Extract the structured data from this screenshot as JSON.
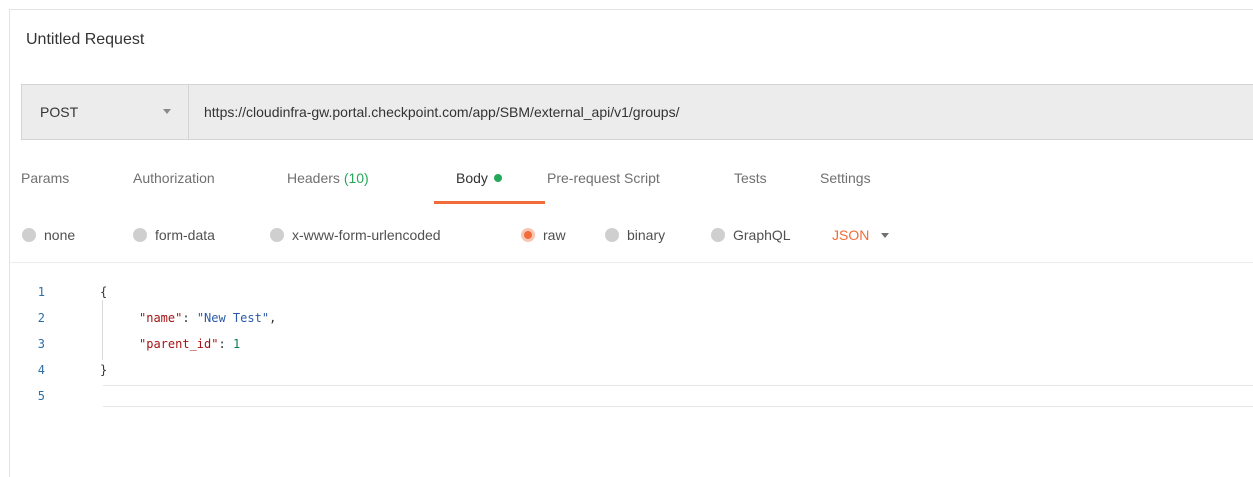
{
  "request": {
    "title": "Untitled Request",
    "method": "POST",
    "url": "https://cloudinfra-gw.portal.checkpoint.com/app/SBM/external_api/v1/groups/"
  },
  "tabs": {
    "params": "Params",
    "authorization": "Authorization",
    "headers": "Headers",
    "headers_count": "(10)",
    "body": "Body",
    "prerequest": "Pre-request Script",
    "tests": "Tests",
    "settings": "Settings"
  },
  "body_modes": {
    "none": "none",
    "form_data": "form-data",
    "urlencoded": "x-www-form-urlencoded",
    "raw": "raw",
    "binary": "binary",
    "graphql": "GraphQL",
    "format": "JSON",
    "selected": "raw"
  },
  "editor": {
    "line_numbers": [
      "1",
      "2",
      "3",
      "4",
      "5"
    ],
    "open_brace": "{",
    "close_brace": "}",
    "key1": "\"name\"",
    "val1": "\"New Test\"",
    "key2": "\"parent_id\"",
    "val2": "1"
  },
  "colors": {
    "accent": "#f26b3a",
    "active_dot": "#26a85a"
  }
}
